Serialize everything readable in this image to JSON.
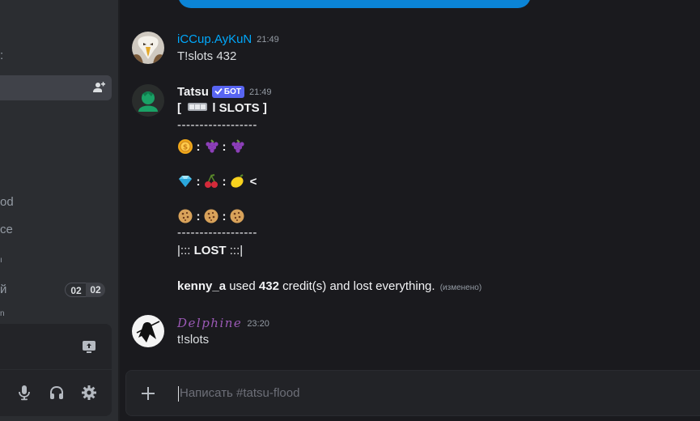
{
  "sidebar": {
    "fragments": [
      ":",
      "od",
      "ce",
      "ı",
      "й",
      "n"
    ],
    "badge": {
      "left": "02",
      "right": "02"
    },
    "icons": [
      "add-member-icon",
      "screen-share-icon",
      "microphone-icon",
      "headphones-icon",
      "gear-icon"
    ]
  },
  "messages": [
    {
      "author": "iCCup.AyKuN",
      "author_color": "#00a8fc",
      "time": "21:49",
      "text": "T!slots 432"
    },
    {
      "author": "Tatsu",
      "author_color": "#f2f3f5",
      "bot_tag": "БОТ",
      "time": "21:49",
      "slots_title_open": "[",
      "slots_title": "l SLOTS ]",
      "dashes_top": "------------------",
      "rows": [
        {
          "cells": [
            "coin-icon",
            "grapes-icon",
            "grapes-icon"
          ],
          "marker": ""
        },
        {
          "cells": [
            "diamond-icon",
            "cherries-icon",
            "lemon-icon"
          ],
          "marker": "<"
        },
        {
          "cells": [
            "cookie-icon",
            "cookie-icon",
            "cookie-icon"
          ],
          "marker": ""
        }
      ],
      "dashes_bottom": "------------------",
      "result_prefix": "|:::",
      "result_word": "LOST",
      "result_suffix": ":::|",
      "summary_user": "kenny_a",
      "summary_used": "used",
      "summary_amount": "432",
      "summary_rest": "credit(s) and lost everything.",
      "edited": "(изменено)"
    },
    {
      "author": "Delphine",
      "author_color": "#9b59b6",
      "time": "23:20",
      "text": "t!slots"
    }
  ],
  "input": {
    "placeholder": "Написать #tatsu-flood"
  },
  "colors": {
    "background": "#1a1a1e",
    "sidebar": "#2b2d31",
    "accent": "#5865f2",
    "link": "#00a8fc"
  }
}
